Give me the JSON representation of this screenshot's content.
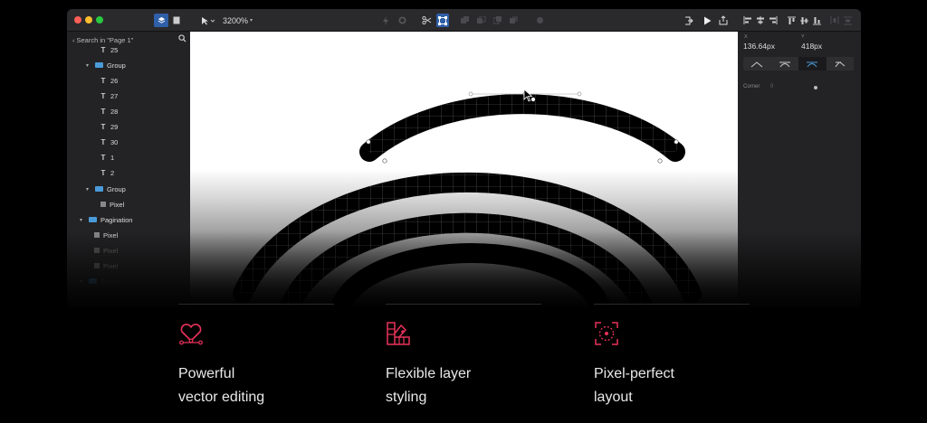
{
  "toolbar": {
    "zoom": "3200%"
  },
  "sidebar": {
    "search_label": "Search in \"Page 1\"",
    "layers": [
      {
        "label": "25",
        "kind": "text"
      },
      {
        "label": "Group",
        "kind": "group"
      },
      {
        "label": "26",
        "kind": "text"
      },
      {
        "label": "27",
        "kind": "text"
      },
      {
        "label": "28",
        "kind": "text"
      },
      {
        "label": "29",
        "kind": "text"
      },
      {
        "label": "30",
        "kind": "text"
      },
      {
        "label": "1",
        "kind": "text"
      },
      {
        "label": "2",
        "kind": "text"
      },
      {
        "label": "Group",
        "kind": "group"
      },
      {
        "label": "Pixel",
        "kind": "shape"
      },
      {
        "label": "Pagination",
        "kind": "group"
      },
      {
        "label": "Pixel",
        "kind": "shape"
      },
      {
        "label": "Pixel",
        "kind": "shape"
      },
      {
        "label": "Pixel",
        "kind": "shape"
      },
      {
        "label": "Button",
        "kind": "group"
      }
    ]
  },
  "inspector": {
    "x_label": "X",
    "y_label": "Y",
    "x_value": "136.64px",
    "y_value": "418px",
    "corner_label": "Corner",
    "corner_value": "0"
  },
  "features": [
    {
      "line1": "Powerful",
      "line2": "vector editing",
      "icon": "heart-pen-icon"
    },
    {
      "line1": "Flexible layer",
      "line2": "styling",
      "icon": "swatch-icon"
    },
    {
      "line1": "Pixel-perfect",
      "line2": "layout",
      "icon": "frame-target-icon"
    }
  ],
  "colors": {
    "accent": "#e8325a",
    "selection": "#2f7fe0"
  }
}
